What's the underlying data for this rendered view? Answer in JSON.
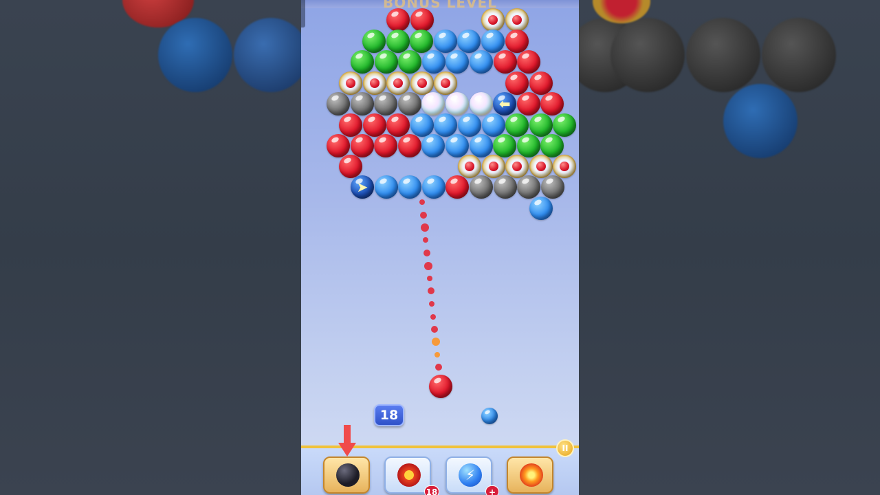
{
  "level": {
    "title": "BONUS LEVEL"
  },
  "moves_left": "18",
  "boosters": [
    {
      "name": "bomb",
      "icon": "bomb-icon",
      "count": ""
    },
    {
      "name": "nuke",
      "icon": "nuke-icon",
      "count": "18"
    },
    {
      "name": "lightning",
      "icon": "lightning-icon",
      "count": "+"
    },
    {
      "name": "fire",
      "icon": "fire-icon",
      "count": ""
    }
  ],
  "shooter_color": "red",
  "next_color": "blue",
  "pause_icon": "pause-icon",
  "colors": {
    "red": "#e0162a",
    "green": "#1fb62a",
    "blue": "#2f8cf0",
    "gray": "#6d6d6d",
    "accent": "#f0c23a"
  }
}
